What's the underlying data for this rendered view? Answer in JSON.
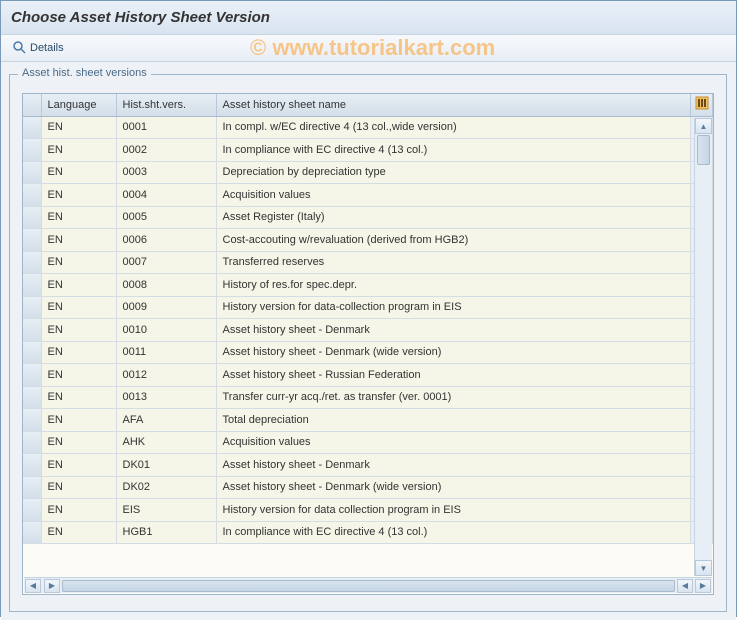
{
  "title": "Choose Asset History Sheet Version",
  "toolbar": {
    "details_label": "Details"
  },
  "panel": {
    "title": "Asset hist. sheet versions"
  },
  "table": {
    "headers": {
      "language": "Language",
      "version": "Hist.sht.vers.",
      "name": "Asset history sheet name"
    },
    "rows": [
      {
        "lang": "EN",
        "vers": "0001",
        "name": "In compl. w/EC directive 4 (13 col.,wide version)"
      },
      {
        "lang": "EN",
        "vers": "0002",
        "name": "In compliance with EC directive 4 (13 col.)"
      },
      {
        "lang": "EN",
        "vers": "0003",
        "name": "Depreciation by depreciation type"
      },
      {
        "lang": "EN",
        "vers": "0004",
        "name": "Acquisition values"
      },
      {
        "lang": "EN",
        "vers": "0005",
        "name": "Asset Register (Italy)"
      },
      {
        "lang": "EN",
        "vers": "0006",
        "name": "Cost-accouting w/revaluation (derived from HGB2)"
      },
      {
        "lang": "EN",
        "vers": "0007",
        "name": "Transferred reserves"
      },
      {
        "lang": "EN",
        "vers": "0008",
        "name": "History of res.for spec.depr."
      },
      {
        "lang": "EN",
        "vers": "0009",
        "name": "History version for data-collection program in EIS"
      },
      {
        "lang": "EN",
        "vers": "0010",
        "name": "Asset history sheet - Denmark"
      },
      {
        "lang": "EN",
        "vers": "0011",
        "name": "Asset history sheet - Denmark (wide version)"
      },
      {
        "lang": "EN",
        "vers": "0012",
        "name": "Asset history sheet - Russian Federation"
      },
      {
        "lang": "EN",
        "vers": "0013",
        "name": "Transfer curr-yr acq./ret. as transfer (ver. 0001)"
      },
      {
        "lang": "EN",
        "vers": "AFA",
        "name": "Total depreciation"
      },
      {
        "lang": "EN",
        "vers": "AHK",
        "name": "Acquisition values"
      },
      {
        "lang": "EN",
        "vers": "DK01",
        "name": "Asset history sheet - Denmark"
      },
      {
        "lang": "EN",
        "vers": "DK02",
        "name": "Asset history sheet - Denmark (wide version)"
      },
      {
        "lang": "EN",
        "vers": "EIS",
        "name": "History version for data collection program in EIS"
      },
      {
        "lang": "EN",
        "vers": "HGB1",
        "name": "In compliance with EC directive 4 (13 col.)"
      }
    ]
  },
  "watermark": "© www.tutorialkart.com"
}
